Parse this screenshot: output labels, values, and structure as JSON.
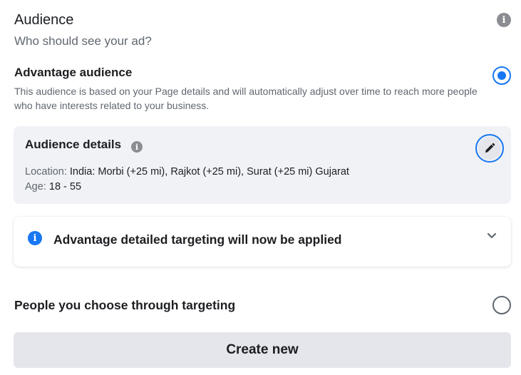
{
  "header": {
    "title": "Audience",
    "subtitle": "Who should see your ad?",
    "info_icon": "i"
  },
  "advantage_option": {
    "title": "Advantage audience",
    "description": "This audience is based on your Page details and will automatically adjust over time to reach more people who have interests related to your business.",
    "selected": true
  },
  "audience_details": {
    "title": "Audience details",
    "info_icon": "i",
    "location_label": "Location:",
    "location_value": "India: Morbi (+25 mi), Rajkot (+25 mi), Surat (+25 mi) Gujarat",
    "age_label": "Age:",
    "age_value": "18 - 55",
    "edit_icon": "pencil-icon"
  },
  "notice": {
    "info_icon": "i",
    "text": "Advantage detailed targeting will now be applied",
    "expand_icon": "chevron-down-icon"
  },
  "targeting_option": {
    "title": "People you choose through targeting",
    "selected": false
  },
  "create_button": {
    "label": "Create new"
  },
  "colors": {
    "accent": "#1877f2",
    "card_background": "#f0f2f5",
    "button_background": "#e4e6eb",
    "secondary_text": "#606770"
  }
}
